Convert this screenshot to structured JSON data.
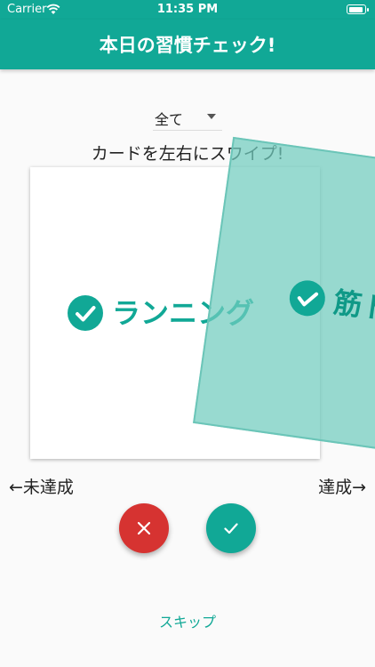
{
  "status_bar": {
    "carrier": "Carrier",
    "time": "11:35 PM"
  },
  "app_bar": {
    "title": "本日の習慣チェック!"
  },
  "filter": {
    "selected": "全て"
  },
  "hint": "カードを左右にスワイプ!",
  "cards": {
    "back": {
      "label": "ランニング"
    },
    "front": {
      "label": "筋トレ"
    }
  },
  "swipe_labels": {
    "left": "←未達成",
    "right": "達成→"
  },
  "skip_label": "スキップ",
  "colors": {
    "primary": "#11a896",
    "danger": "#d63331",
    "overlay": "#70ccbe"
  }
}
